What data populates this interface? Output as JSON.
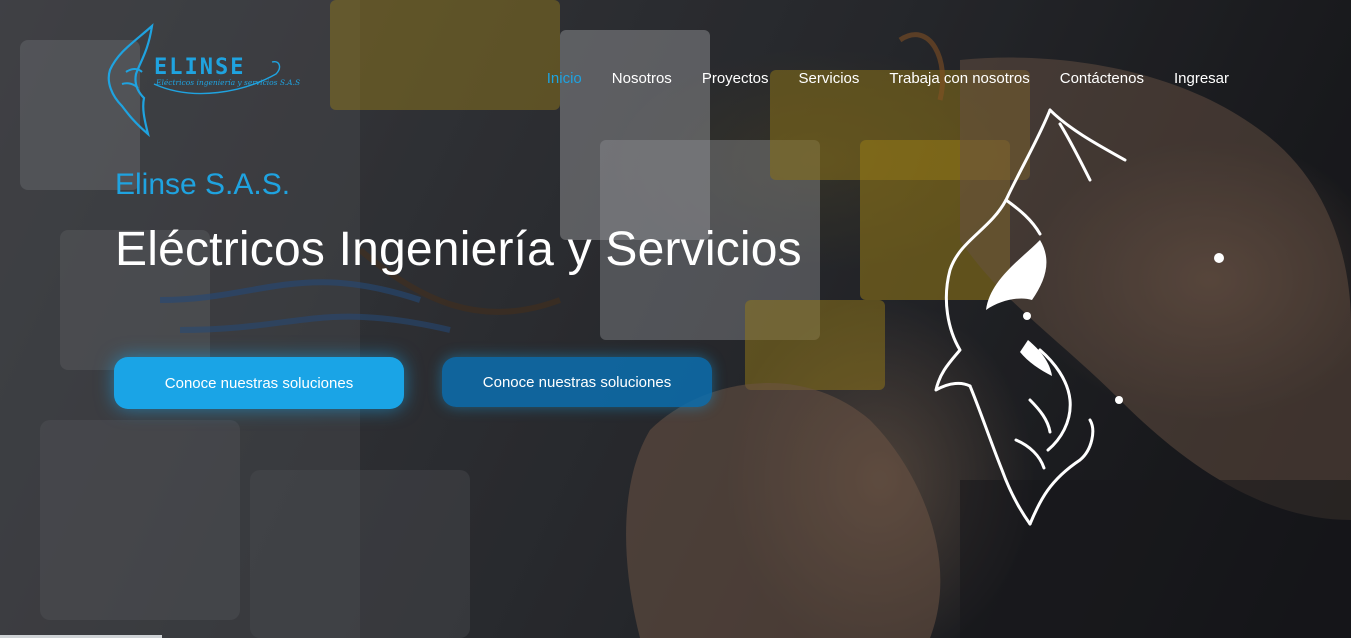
{
  "brand": {
    "logo_word": "ELINSE",
    "logo_tagline": "Eléctricos ingeniería y servicios S.A.S",
    "accent_color": "#1fa3e0"
  },
  "nav": {
    "items": [
      {
        "label": "Inicio",
        "active": true
      },
      {
        "label": "Nosotros"
      },
      {
        "label": "Proyectos"
      },
      {
        "label": "Servicios"
      },
      {
        "label": "Trabaja con nosotros"
      },
      {
        "label": "Contáctenos"
      },
      {
        "label": "Ingresar"
      }
    ]
  },
  "hero": {
    "eyebrow": "Elinse S.A.S.",
    "headline": "Eléctricos Ingeniería y Servicios",
    "primary_button": "Conoce nuestras soluciones",
    "secondary_button": "Conoce nuestras soluciones",
    "background_image": "electrician-hands-wiring-panel",
    "decorative_icon": "wolf-head-icon"
  }
}
